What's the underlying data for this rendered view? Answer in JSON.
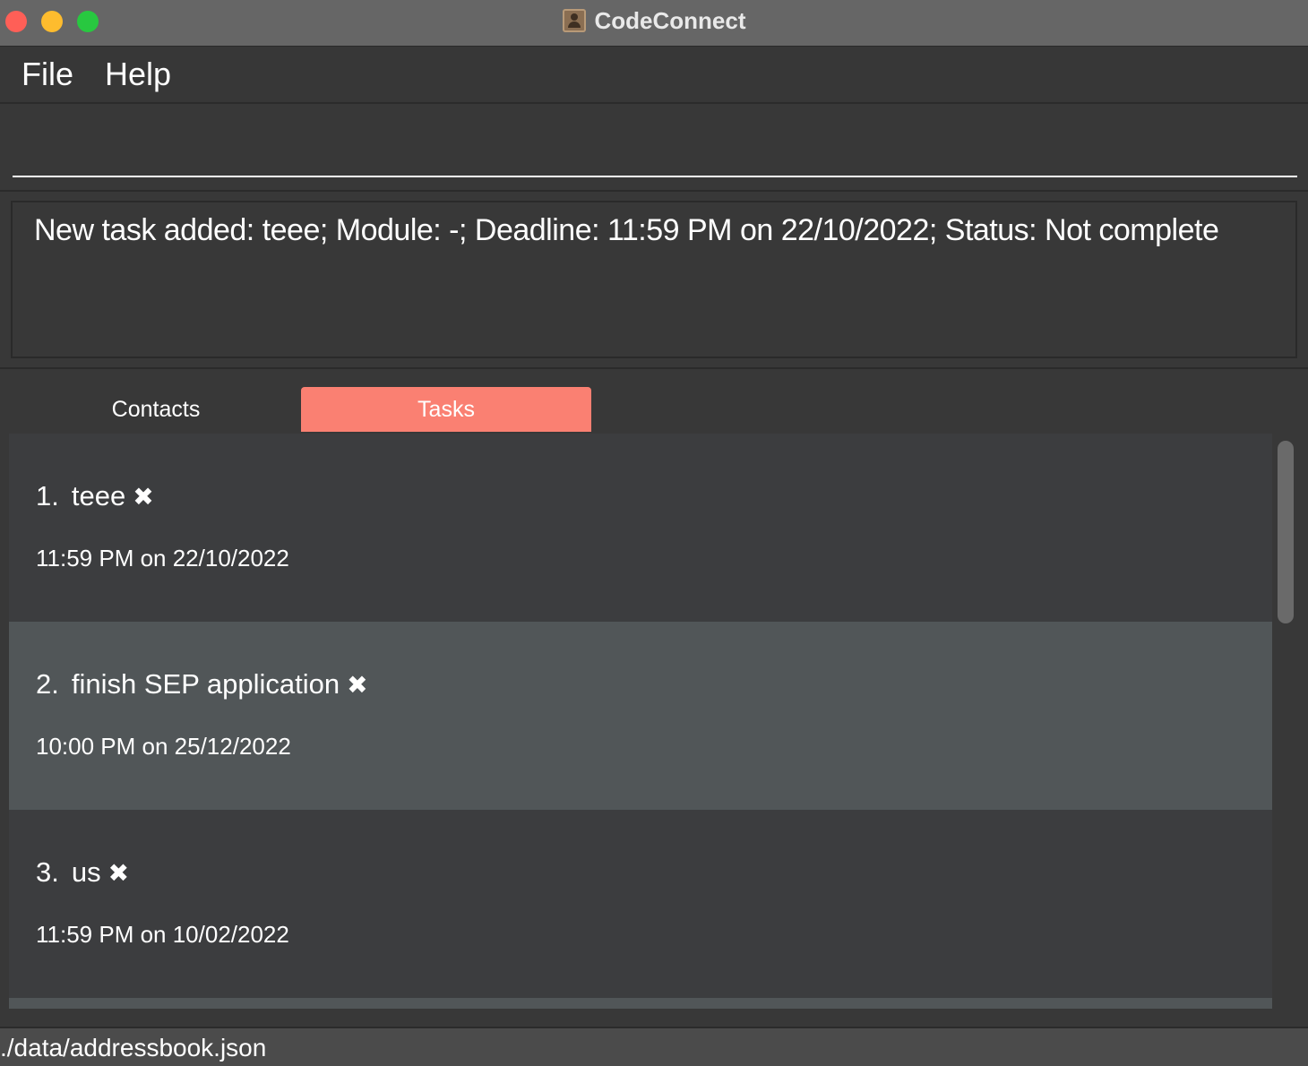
{
  "window": {
    "title": "CodeConnect",
    "app_icon": "contacts-book-icon"
  },
  "menu": {
    "file_label": "File",
    "help_label": "Help"
  },
  "command": {
    "value": "",
    "placeholder": ""
  },
  "result": {
    "message": "New task added: teee; Module: -; Deadline: 11:59 PM on 22/10/2022; Status: Not complete"
  },
  "tabs": {
    "contacts_label": "Contacts",
    "tasks_label": "Tasks",
    "active": "Tasks",
    "active_color": "#fa8072"
  },
  "tasks": [
    {
      "index": "1.",
      "name": "teee",
      "status_icon": "✖",
      "deadline": "11:59 PM on 22/10/2022"
    },
    {
      "index": "2.",
      "name": "finish SEP application",
      "status_icon": "✖",
      "deadline": "10:00 PM on 25/12/2022"
    },
    {
      "index": "3.",
      "name": "us",
      "status_icon": "✖",
      "deadline": "11:59 PM on 10/02/2022"
    }
  ],
  "status_bar": {
    "file_path": "./data/addressbook.json"
  }
}
